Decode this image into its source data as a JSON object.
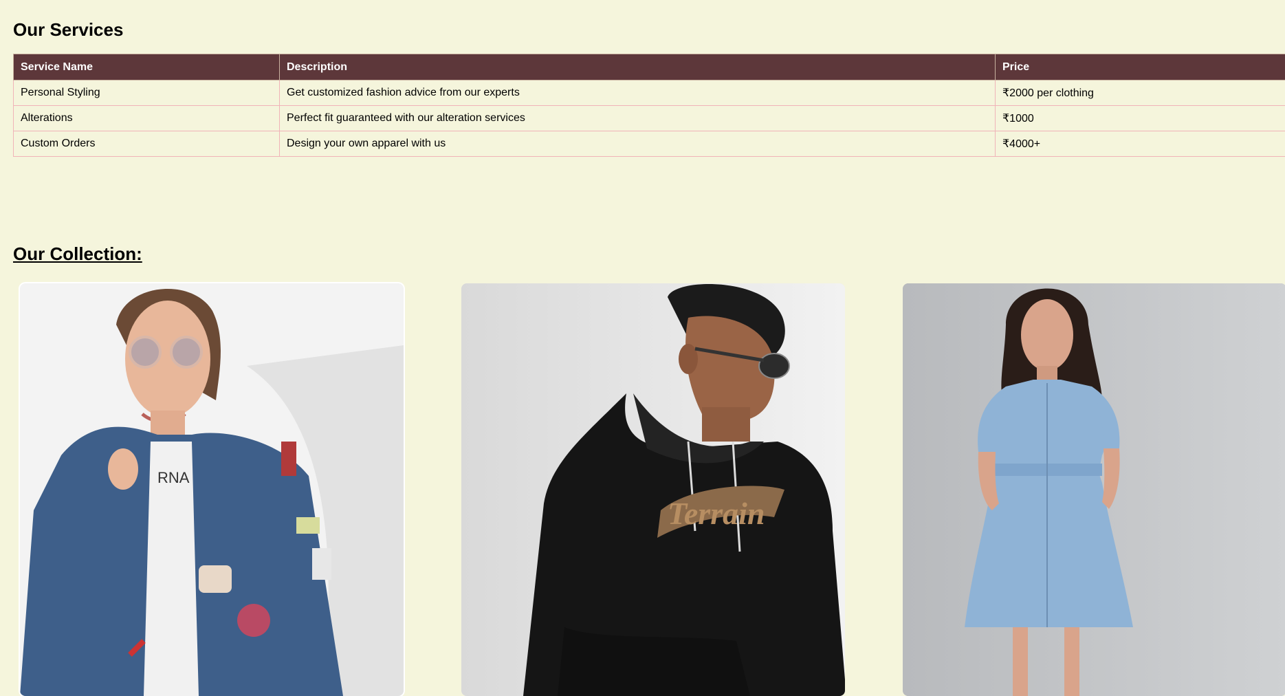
{
  "services": {
    "title": "Our Services",
    "columns": [
      "Service Name",
      "Description",
      "Price"
    ],
    "rows": [
      {
        "name": "Personal Styling",
        "description": "Get customized fashion advice from our experts",
        "price": "₹2000 per clothing"
      },
      {
        "name": "Alterations",
        "description": "Perfect fit guaranteed with our alteration services",
        "price": "₹1000"
      },
      {
        "name": "Custom Orders",
        "description": "Design your own apparel with us",
        "price": "₹4000+"
      }
    ]
  },
  "collection": {
    "title": "Our Collection:",
    "items": [
      {
        "image": "woman-denim-jacket-photo"
      },
      {
        "image": "man-black-hoodie-photo",
        "print_text": "Terrain"
      },
      {
        "image": "woman-denim-dress-photo"
      }
    ]
  },
  "colors": {
    "page_background": "#f5f5dc",
    "table_header": "#5d373a",
    "table_border": "#f0b3b8"
  }
}
